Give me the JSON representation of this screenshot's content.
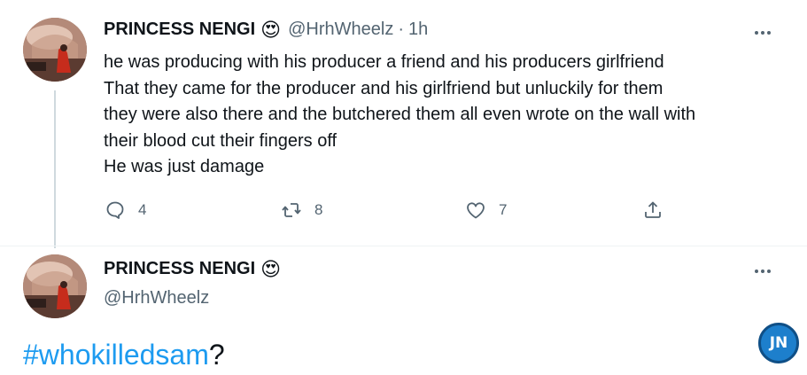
{
  "tweet1": {
    "display_name": "PRINCESS NENGI",
    "emoji": "😍",
    "handle": "@HrhWheelz",
    "separator": "·",
    "time": "1h",
    "text_lines": [
      "he was producing with his producer a friend and his producers girlfriend",
      "That they came for the producer and his girlfriend but unluckily for them",
      "they were also there and the butchered them all even wrote on the wall with",
      "their blood cut their fingers off",
      "He was just damage"
    ],
    "actions": {
      "reply_count": "4",
      "retweet_count": "8",
      "like_count": "7"
    }
  },
  "tweet2": {
    "display_name": "PRINCESS NENGI",
    "emoji": "😍",
    "handle": "@HrhWheelz",
    "hashtag": "#whokilledsam",
    "suffix": "?"
  },
  "watermark": {
    "label": "JN"
  },
  "icons": {
    "reply": "reply-icon",
    "retweet": "retweet-icon",
    "like": "heart-icon",
    "share": "share-icon",
    "more": "more-icon"
  },
  "colors": {
    "text": "#0f1419",
    "secondary": "#536471",
    "link": "#1d9bf0",
    "thread_line": "#cfd9de"
  }
}
